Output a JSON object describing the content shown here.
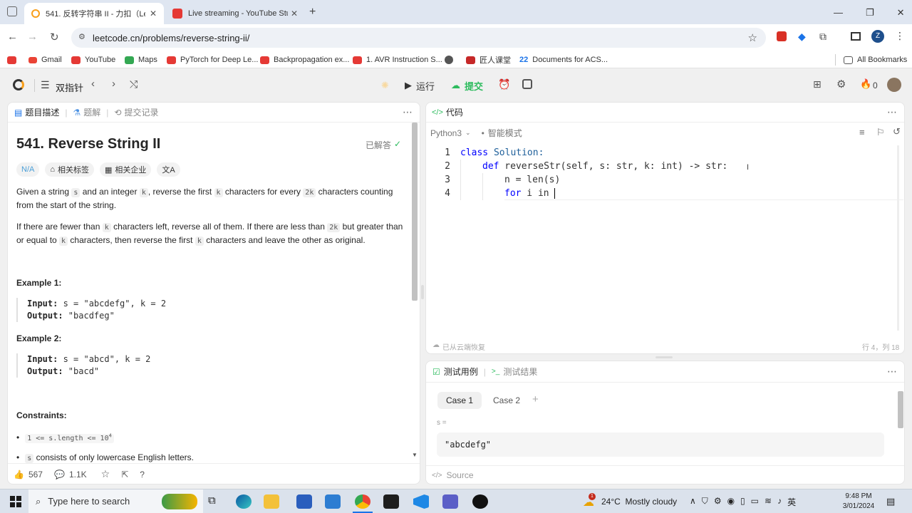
{
  "browser": {
    "tabs": [
      {
        "title": "541. 反转字符串 II - 力扣（Leet",
        "active": true
      },
      {
        "title": "Live streaming - YouTube Studi",
        "active": false
      }
    ],
    "url": "leetcode.cn/problems/reverse-string-ii/",
    "profile_initial": "Z",
    "bookmarks": [
      "Gmail",
      "YouTube",
      "Maps",
      "PyTorch for Deep Le...",
      "Backpropagation ex...",
      "1. AVR Instruction S...",
      "",
      "匠人课堂",
      "Documents for ACS..."
    ],
    "all_bookmarks": "All Bookmarks"
  },
  "header": {
    "list_title": "双指针",
    "run_label": "运行",
    "submit_label": "提交",
    "streak_count": "0"
  },
  "left": {
    "tabs": [
      "题目描述",
      "题解",
      "提交记录"
    ],
    "title": "541. Reverse String II",
    "solved": "已解答",
    "difficulty": "N/A",
    "tags": [
      "相关标签",
      "相关企业"
    ],
    "p1": {
      "a": "Given a string ",
      "s": "s",
      "b": " and an integer ",
      "k": "k",
      "c": ", reverse the first ",
      "k2": "k",
      "d": " characters for every ",
      "k3": "2k",
      "e": " characters counting from the start of the string."
    },
    "p2": {
      "a": "If there are fewer than ",
      "k": "k",
      "b": " characters left, reverse all of them. If there are less than ",
      "k2": "2k",
      "c": " but greater than or equal to ",
      "k3": "k",
      "d": " characters, then reverse the first ",
      "k4": "k",
      "e": " characters and leave the other as original."
    },
    "example1": {
      "title": "Example 1:",
      "input_label": "Input:",
      "input": " s = \"abcdefg\", k = 2",
      "output_label": "Output:",
      "output": " \"bacdfeg\""
    },
    "example2": {
      "title": "Example 2:",
      "input_label": "Input:",
      "input": " s = \"abcd\", k = 2",
      "output_label": "Output:",
      "output": " \"bacd\""
    },
    "constraints_title": "Constraints:",
    "constraint1": "1 <= s.length <= 10",
    "constraint1_exp": "4",
    "constraint2_code": "s",
    "constraint2": " consists of only lowercase English letters.",
    "likes": "567",
    "comments": "1.1K"
  },
  "code": {
    "title": "代码",
    "language": "Python3",
    "mode": "智能模式",
    "lines": [
      {
        "num": "1",
        "kw": "class",
        "rest": " Solution:",
        "indent": 0
      },
      {
        "num": "2",
        "kw": "def",
        "rest": " reverseStr(self, s: str, k: int) -> str:",
        "indent": 4
      },
      {
        "num": "3",
        "kw": "",
        "rest": "n = len(s)",
        "indent": 8
      },
      {
        "num": "4",
        "kw": "for",
        "rest": " i in ",
        "indent": 8
      }
    ],
    "restored": "已从云端恢复",
    "position": "行 4，列 18"
  },
  "test": {
    "tab_cases": "测试用例",
    "tab_results": "测试结果",
    "cases": [
      "Case 1",
      "Case 2"
    ],
    "var_label": "s =",
    "value": "\"abcdefg\"",
    "source": "Source"
  },
  "taskbar": {
    "search_placeholder": "Type here to search",
    "weather": "24°C  Mostly cloudy",
    "ime": "英",
    "time": "9:48 PM",
    "date": "3/01/2024",
    "notification_badge": "1"
  },
  "colors": {
    "green": "#2cbb5d",
    "lc_orange": "#ffa116",
    "red": "#d93025"
  }
}
